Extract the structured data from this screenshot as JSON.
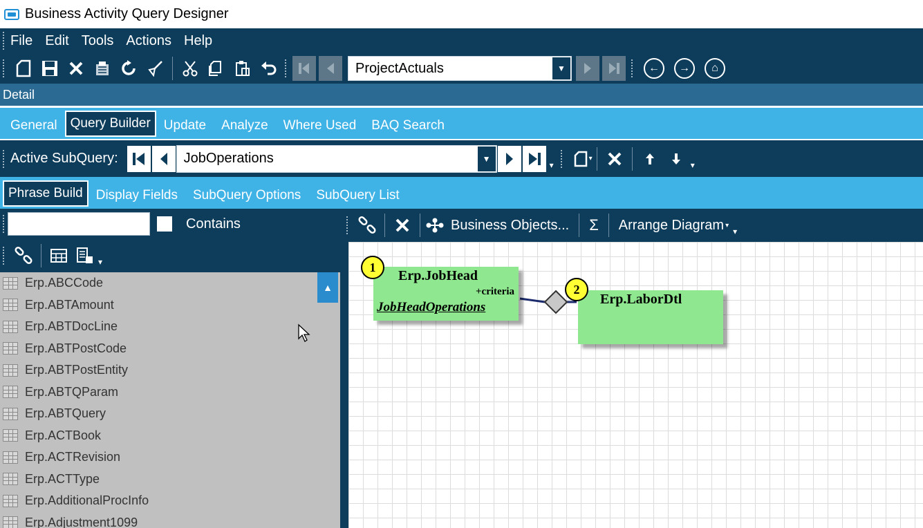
{
  "window": {
    "title": "Business Activity Query Designer"
  },
  "menu": {
    "items": [
      "File",
      "Edit",
      "Tools",
      "Actions",
      "Help"
    ]
  },
  "toolbar": {
    "query_selector_value": "ProjectActuals"
  },
  "detail_bar": {
    "label": "Detail"
  },
  "top_tabs": [
    "General",
    "Query Builder",
    "Update",
    "Analyze",
    "Where Used",
    "BAQ Search"
  ],
  "subquery": {
    "label": "Active SubQuery:",
    "value": "JobOperations"
  },
  "sub_tabs": [
    "Phrase Build",
    "Display Fields",
    "SubQuery Options",
    "SubQuery List"
  ],
  "filter": {
    "value": "",
    "contains_label": "Contains"
  },
  "tables": [
    "Erp.ABCCode",
    "Erp.ABTAmount",
    "Erp.ABTDocLine",
    "Erp.ABTPostCode",
    "Erp.ABTPostEntity",
    "Erp.ABTQParam",
    "Erp.ABTQuery",
    "Erp.ACTBook",
    "Erp.ACTRevision",
    "Erp.ACTType",
    "Erp.AdditionalProcInfo",
    "Erp.Adjustment1099"
  ],
  "diagram_toolbar": {
    "business_objects": "Business Objects...",
    "sigma": "Σ",
    "arrange": "Arrange Diagram"
  },
  "diagram": {
    "node1": {
      "num": "1",
      "title": "Erp.JobHead",
      "criteria": "+criteria",
      "relation": "JobHeadOperations"
    },
    "node2": {
      "num": "2",
      "title": "Erp.LaborDtl"
    }
  }
}
